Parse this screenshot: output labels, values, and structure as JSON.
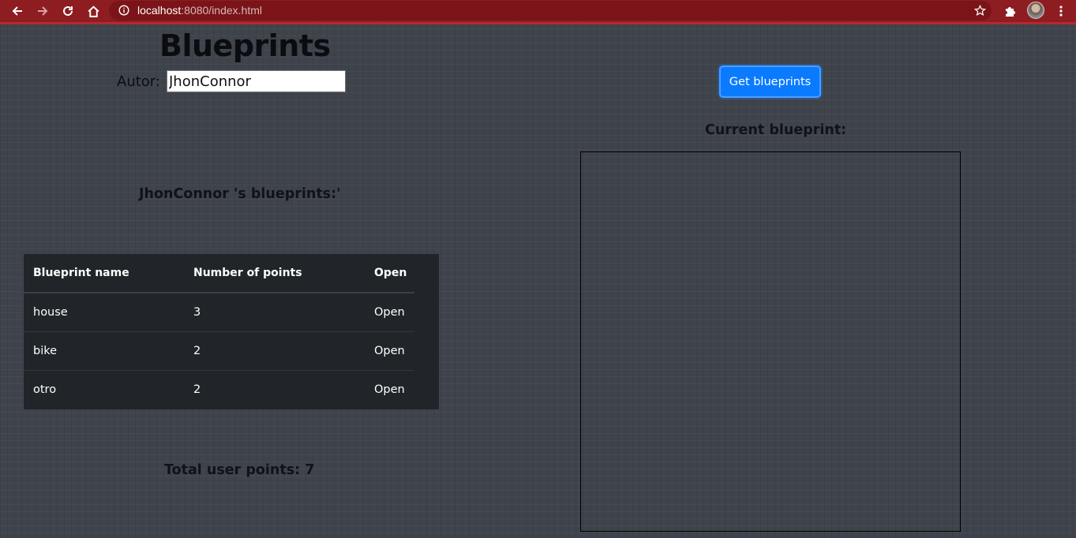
{
  "browser": {
    "url_host": "localhost",
    "url_path": ":8080/index.html"
  },
  "page": {
    "title": "Blueprints",
    "author_label": "Autor:",
    "author_value": "JhonConnor",
    "get_button_label": "Get blueprints",
    "current_label": "Current blueprint:",
    "owner_name": "JhonConnor",
    "owner_suffix": " 's blueprints:'",
    "total_label": "Total user points: 7"
  },
  "table": {
    "headers": [
      "Blueprint name",
      "Number of points",
      "Open"
    ],
    "rows": [
      {
        "name": "house",
        "points": "3",
        "open": "Open"
      },
      {
        "name": "bike",
        "points": "2",
        "open": "Open"
      },
      {
        "name": "otro",
        "points": "2",
        "open": "Open"
      }
    ]
  },
  "colors": {
    "browser_bar": "#8d1d21",
    "page_background": "#3f444c",
    "table_background": "#212529",
    "button_primary": "#0a7bff"
  },
  "icons": {
    "back": "arrow-left",
    "forward": "arrow-right",
    "reload": "reload",
    "home": "home",
    "site_info": "info-circle",
    "bookmark": "star-outline",
    "extensions": "puzzle-piece",
    "menu": "three-dots-vertical"
  }
}
